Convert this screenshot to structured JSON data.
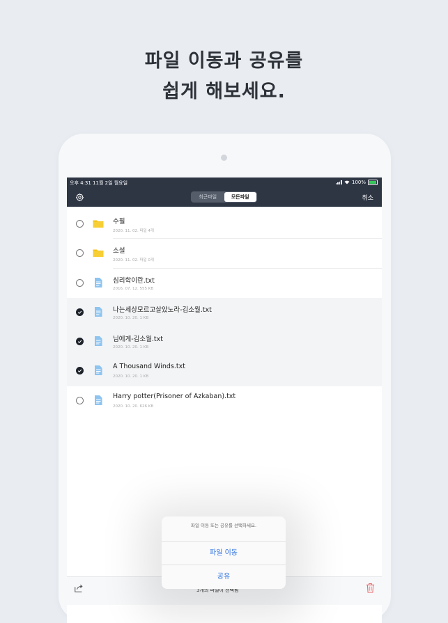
{
  "headline": {
    "line1": "파일 이동과 공유를",
    "line2": "쉽게 해보세요."
  },
  "status_bar": {
    "time": "오후 4:31   11월 2일 월요일",
    "battery": "100%"
  },
  "nav": {
    "tabs": [
      {
        "label": "최근파일",
        "active": false
      },
      {
        "label": "모든파일",
        "active": true
      }
    ],
    "cancel_label": "취소"
  },
  "files": [
    {
      "name": "수필",
      "meta": "2020. 11. 02. 파일 4개",
      "icon": "folder-icon",
      "selected": false
    },
    {
      "name": "소설",
      "meta": "2020. 11. 02. 파일 0개",
      "icon": "folder-icon",
      "selected": false
    },
    {
      "name": "심리학이란.txt",
      "meta": "2016. 07. 12. 555 KB",
      "icon": "text-file-icon",
      "selected": false
    },
    {
      "name": "나는세상모르고살았노라-김소월.txt",
      "meta": "2020. 10. 20. 1 KB",
      "icon": "text-file-icon",
      "selected": true
    },
    {
      "name": "님에게-김소월.txt",
      "meta": "2020. 10. 20. 1 KB",
      "icon": "text-file-icon",
      "selected": true
    },
    {
      "name": "A Thousand Winds.txt",
      "meta": "2020. 10. 20. 1 KB",
      "icon": "text-file-icon",
      "selected": true
    },
    {
      "name": "Harry potter(Prisoner of Azkaban).txt",
      "meta": "2020. 10. 20. 626 KB",
      "icon": "text-file-icon",
      "selected": false
    }
  ],
  "bottom_bar": {
    "hint": "3개의 파일이 선택됨"
  },
  "action_sheet": {
    "message": "파일 이동 또는 공유를 선택하세요.",
    "move_label": "파일 이동",
    "share_label": "공유"
  },
  "colors": {
    "navbar": "#2e3644",
    "accent": "#2a6fe0",
    "folder": "#f5c518",
    "file": "#8dc4f0",
    "trash": "#e86a6a"
  }
}
